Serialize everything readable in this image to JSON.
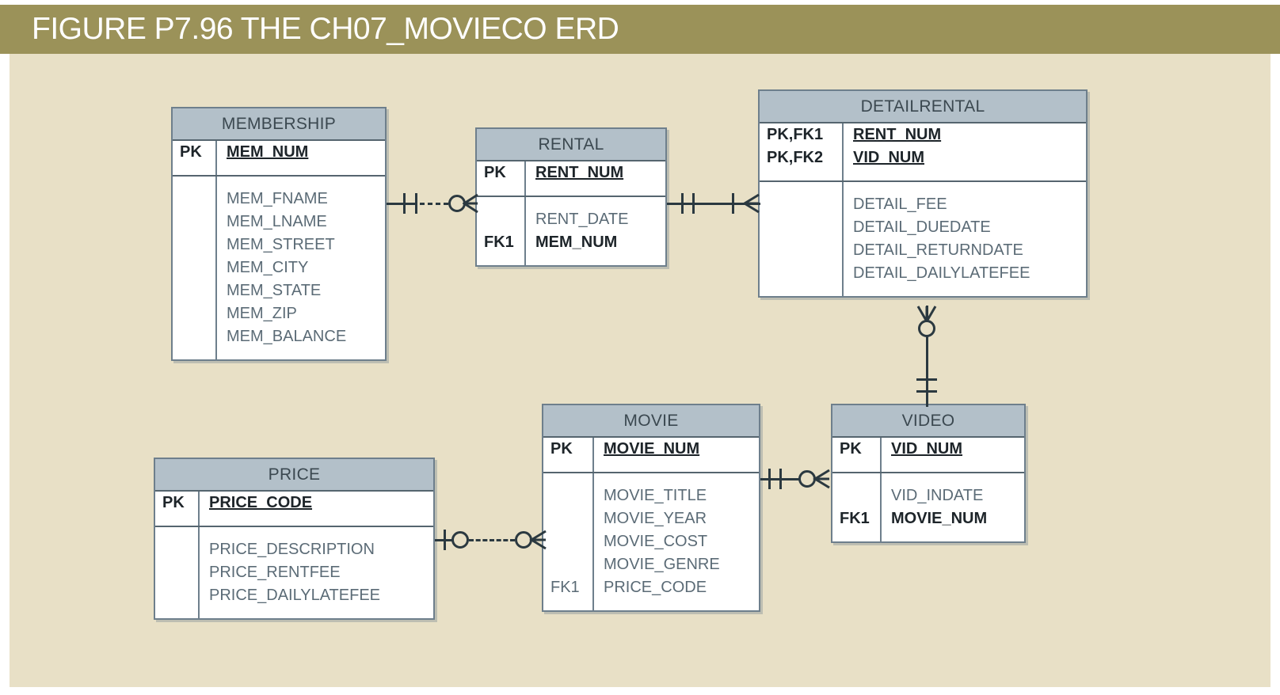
{
  "figure": {
    "banner_text": "FIGURE P7.96  THE CH07_MOVIECO ERD",
    "banner_color": "#9b9259",
    "canvas_color": "#e8e0c6",
    "entity_header_color": "#b3c0c9",
    "entity_border_color": "#6e7f8c"
  },
  "entities": {
    "membership": {
      "title": "MEMBERSHIP",
      "pk_rows": [
        {
          "key": "PK",
          "name": "MEM_NUM"
        }
      ],
      "attr_rows": [
        {
          "key": "",
          "name": "MEM_FNAME"
        },
        {
          "key": "",
          "name": "MEM_LNAME"
        },
        {
          "key": "",
          "name": "MEM_STREET"
        },
        {
          "key": "",
          "name": "MEM_CITY"
        },
        {
          "key": "",
          "name": "MEM_STATE"
        },
        {
          "key": "",
          "name": "MEM_ZIP"
        },
        {
          "key": "",
          "name": "MEM_BALANCE"
        }
      ]
    },
    "rental": {
      "title": "RENTAL",
      "pk_rows": [
        {
          "key": "PK",
          "name": "RENT_NUM"
        }
      ],
      "attr_rows": [
        {
          "key": "",
          "name": "RENT_DATE"
        },
        {
          "key": "FK1",
          "name": "MEM_NUM"
        }
      ]
    },
    "detailrental": {
      "title": "DETAILRENTAL",
      "pk_rows": [
        {
          "key": "PK,FK1",
          "name": "RENT_NUM"
        },
        {
          "key": "PK,FK2",
          "name": "VID_NUM"
        }
      ],
      "attr_rows": [
        {
          "key": "",
          "name": "DETAIL_FEE"
        },
        {
          "key": "",
          "name": "DETAIL_DUEDATE"
        },
        {
          "key": "",
          "name": "DETAIL_RETURNDATE"
        },
        {
          "key": "",
          "name": "DETAIL_DAILYLATEFEE"
        }
      ]
    },
    "movie": {
      "title": "MOVIE",
      "pk_rows": [
        {
          "key": "PK",
          "name": "MOVIE_NUM"
        }
      ],
      "attr_rows": [
        {
          "key": "",
          "name": "MOVIE_TITLE"
        },
        {
          "key": "",
          "name": "MOVIE_YEAR"
        },
        {
          "key": "",
          "name": "MOVIE_COST"
        },
        {
          "key": "",
          "name": "MOVIE_GENRE"
        },
        {
          "key": "FK1",
          "name": "PRICE_CODE"
        }
      ]
    },
    "video": {
      "title": "VIDEO",
      "pk_rows": [
        {
          "key": "PK",
          "name": "VID_NUM"
        }
      ],
      "attr_rows": [
        {
          "key": "",
          "name": "VID_INDATE"
        },
        {
          "key": "FK1",
          "name": "MOVIE_NUM"
        }
      ]
    },
    "price": {
      "title": "PRICE",
      "pk_rows": [
        {
          "key": "PK",
          "name": "PRICE_CODE"
        }
      ],
      "attr_rows": [
        {
          "key": "",
          "name": "PRICE_DESCRIPTION"
        },
        {
          "key": "",
          "name": "PRICE_RENTFEE"
        },
        {
          "key": "",
          "name": "PRICE_DAILYLATEFEE"
        }
      ]
    }
  },
  "relationships": [
    {
      "id": "membership-rental",
      "from": "MEMBERSHIP",
      "to": "RENTAL",
      "line_style": "dashed",
      "kind": "non-identifying",
      "from_cardinality": "one-and-only-one",
      "to_cardinality": "zero-or-many"
    },
    {
      "id": "rental-detailrental",
      "from": "RENTAL",
      "to": "DETAILRENTAL",
      "line_style": "solid",
      "kind": "identifying",
      "from_cardinality": "one-and-only-one",
      "to_cardinality": "one-or-many"
    },
    {
      "id": "video-detailrental",
      "from": "VIDEO",
      "to": "DETAILRENTAL",
      "line_style": "solid",
      "kind": "identifying",
      "from_cardinality": "one-and-only-one",
      "to_cardinality": "zero-or-many"
    },
    {
      "id": "movie-video",
      "from": "MOVIE",
      "to": "VIDEO",
      "line_style": "solid",
      "kind": "identifying",
      "from_cardinality": "one-and-only-one",
      "to_cardinality": "zero-or-many"
    },
    {
      "id": "price-movie",
      "from": "PRICE",
      "to": "MOVIE",
      "line_style": "dashed",
      "kind": "non-identifying",
      "from_cardinality": "zero-or-one",
      "to_cardinality": "zero-or-many"
    }
  ]
}
